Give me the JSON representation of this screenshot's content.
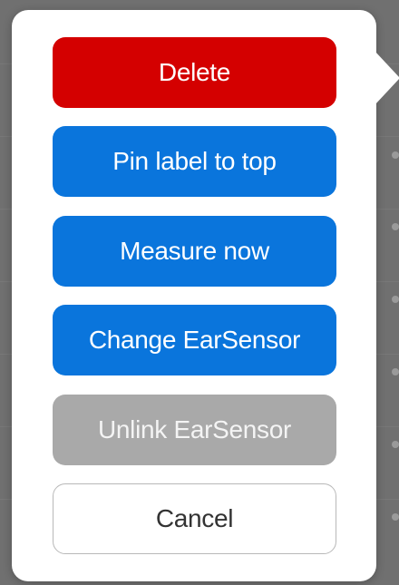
{
  "colors": {
    "delete": "#d40000",
    "primary": "#0a75dc",
    "disabled": "#a9a9a9",
    "cancel_border": "#b8b8b8"
  },
  "menu": {
    "delete_label": "Delete",
    "pin_label": "Pin label to top",
    "measure_label": "Measure now",
    "change_label": "Change EarSensor",
    "unlink_label": "Unlink EarSensor",
    "cancel_label": "Cancel"
  }
}
